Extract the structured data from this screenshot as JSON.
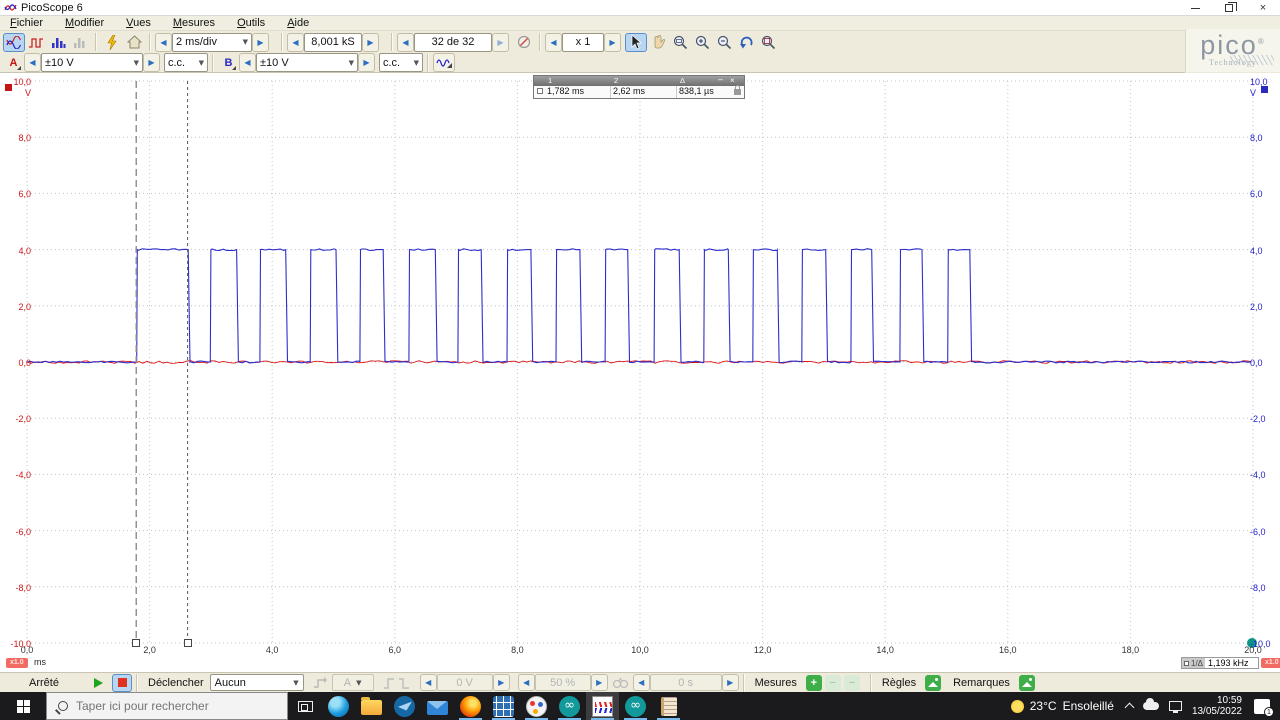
{
  "window": {
    "title": "PicoScope 6"
  },
  "menu": {
    "items": [
      "Fichier",
      "Modifier",
      "Vues",
      "Mesures",
      "Outils",
      "Aide"
    ]
  },
  "toolbar": {
    "timebase": "2 ms/div",
    "samples": "8,001 kS",
    "buffer_position": "32 de 32",
    "zoom_factor": "x 1"
  },
  "channels": {
    "a": {
      "label": "A",
      "range": "±10 V",
      "coupling": "c.c.",
      "color": "#cc1414"
    },
    "b": {
      "label": "B",
      "range": "±10 V",
      "coupling": "c.c.",
      "color": "#2222cc"
    }
  },
  "ruler_overlay": {
    "col1": "1",
    "col2": "2",
    "col_delta": "Δ",
    "ruler1_value": "1,782 ms",
    "ruler2_value": "2,62 ms",
    "delta_value": "838,1 µs"
  },
  "axis_footer": {
    "left_scale_badge": "x1.0",
    "x_unit": "ms",
    "freq_label": "1/Δ",
    "freq_value": "1,193 kHz",
    "right_scale_badge": "x1.0"
  },
  "bottom_bar": {
    "run_state": "Arrêté",
    "trigger_label": "Déclencher",
    "trigger_mode": "Aucun",
    "trigger_source": "A",
    "trigger_level": "0 V",
    "zoom_pct": "50 %",
    "pre_trigger": "0 s",
    "measures_label": "Mesures",
    "rules_label": "Règles",
    "notes_label": "Remarques"
  },
  "logo": {
    "brand": "pico",
    "sub": "Technology"
  },
  "taskbar": {
    "search_placeholder": "Taper ici pour rechercher",
    "apps": [
      {
        "id": "edge",
        "icon": "edge",
        "running": false
      },
      {
        "id": "explorer",
        "icon": "explorer",
        "running": false
      },
      {
        "id": "thunderbird",
        "icon": "thunderbird",
        "running": false
      },
      {
        "id": "mail",
        "icon": "mail",
        "running": false
      },
      {
        "id": "firefox",
        "icon": "firefox",
        "running": true
      },
      {
        "id": "calculator",
        "icon": "calculator",
        "running": true
      },
      {
        "id": "paint3d",
        "icon": "paint3d",
        "running": true
      },
      {
        "id": "arduino",
        "icon": "arduino",
        "running": true
      },
      {
        "id": "picoscope",
        "icon": "picoscope",
        "running": true,
        "active": true
      },
      {
        "id": "arduino-2",
        "icon": "arduino",
        "running": true
      },
      {
        "id": "notes",
        "icon": "notes",
        "running": true
      }
    ],
    "tray": {
      "temp": "23°C",
      "condition": "Ensoleillé",
      "time": "10:59",
      "date": "13/05/2022",
      "notifications": "1"
    }
  },
  "chart_data": {
    "type": "line",
    "title": "Oscilloscope capture: channel B square pulse burst, channel A flat at 0 V",
    "xlabel": "ms",
    "ylabel": "V",
    "xlim": [
      0,
      20
    ],
    "ylim": [
      -10,
      10
    ],
    "grid": true,
    "x_ticks": [
      "0,0",
      "2,0",
      "4,0",
      "6,0",
      "8,0",
      "10,0",
      "12,0",
      "14,0",
      "16,0",
      "18,0",
      "20,0"
    ],
    "y_ticks": [
      "10,0",
      "8,0",
      "6,0",
      "4,0",
      "2,0",
      "0,0",
      "-2,0",
      "-4,0",
      "-6,0",
      "-8,0",
      "-10,0"
    ],
    "y_unit": "V",
    "series": [
      {
        "name": "Channel A",
        "color": "#dc1414",
        "shape": "flat-noise",
        "level_v": 0
      },
      {
        "name": "Channel B",
        "color": "#2e2ecb",
        "shape": "pulse-burst",
        "low_v": 0,
        "high_v": 4,
        "pulses_ms": [
          [
            1.79,
            2.63
          ],
          [
            2.99,
            3.42
          ],
          [
            3.8,
            4.22
          ],
          [
            4.62,
            5.04
          ],
          [
            5.43,
            5.81
          ],
          [
            6.23,
            6.66
          ],
          [
            7.03,
            7.41
          ],
          [
            7.83,
            8.22
          ],
          [
            8.63,
            9.02
          ],
          [
            9.43,
            9.8
          ],
          [
            10.23,
            10.64
          ],
          [
            11.04,
            11.44
          ],
          [
            11.84,
            12.24
          ],
          [
            12.64,
            13.03
          ],
          [
            13.44,
            13.78
          ],
          [
            14.24,
            14.6
          ],
          [
            15.02,
            15.38
          ]
        ]
      }
    ],
    "time_rulers_ms": [
      1.782,
      2.62
    ],
    "legend_position": "none"
  }
}
